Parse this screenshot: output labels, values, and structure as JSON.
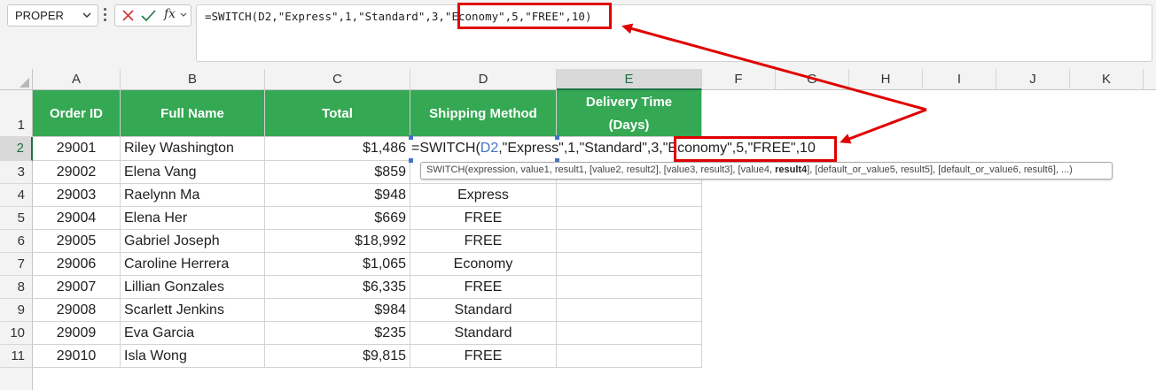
{
  "name_box": {
    "value": "PROPER"
  },
  "formula_bar": {
    "fx_label": "fx",
    "formula": "=SWITCH(D2,\"Express\",1,\"Standard\",3,\"Economy\",5,\"FREE\",10)"
  },
  "columns": [
    "A",
    "B",
    "C",
    "D",
    "E",
    "F",
    "G",
    "H",
    "I",
    "J",
    "K"
  ],
  "rows": [
    "1",
    "2",
    "3",
    "4",
    "5",
    "6",
    "7",
    "8",
    "9",
    "10",
    "11"
  ],
  "table": {
    "headers": {
      "order_id": "Order ID",
      "full_name": "Full Name",
      "total": "Total",
      "shipping_method": "Shipping Method",
      "delivery_time_line1": "Delivery Time",
      "delivery_time_line2": "(Days)"
    },
    "rows": [
      {
        "order_id": "29001",
        "full_name": "Riley Washington",
        "total": "$1,486",
        "shipping_method": ""
      },
      {
        "order_id": "29002",
        "full_name": "Elena Vang",
        "total": "$859",
        "shipping_method": ""
      },
      {
        "order_id": "29003",
        "full_name": "Raelynn Ma",
        "total": "$948",
        "shipping_method": "Express"
      },
      {
        "order_id": "29004",
        "full_name": "Elena Her",
        "total": "$669",
        "shipping_method": "FREE"
      },
      {
        "order_id": "29005",
        "full_name": "Gabriel Joseph",
        "total": "$18,992",
        "shipping_method": "FREE"
      },
      {
        "order_id": "29006",
        "full_name": "Caroline Herrera",
        "total": "$1,065",
        "shipping_method": "Economy"
      },
      {
        "order_id": "29007",
        "full_name": "Lillian Gonzales",
        "total": "$6,335",
        "shipping_method": "FREE"
      },
      {
        "order_id": "29008",
        "full_name": "Scarlett Jenkins",
        "total": "$984",
        "shipping_method": "Standard"
      },
      {
        "order_id": "29009",
        "full_name": "Eva Garcia",
        "total": "$235",
        "shipping_method": "Standard"
      },
      {
        "order_id": "29010",
        "full_name": "Isla Wong",
        "total": "$9,815",
        "shipping_method": "FREE"
      }
    ]
  },
  "cell_editor": {
    "prefix": "=SWITCH(",
    "ref": "D2",
    "middle": ",\"Express\",1,\"Standard\",3,",
    "highlight": "\"Economy\",5,\"FREE\",10"
  },
  "formula_highlight": "\"Economy\",5,\"FREE\",10",
  "tooltip": {
    "before": "SWITCH(expression, value1, result1, [value2, result2], [value3, result3], [value4, ",
    "bold": "result4",
    "after": "], [default_or_value5, result5], [default_or_value6, result6], ...)"
  },
  "colors": {
    "header_fill": "#34a853",
    "annotation_red": "#e00000",
    "reference_blue": "#4472c4",
    "excel_green": "#1e7145"
  },
  "icons": [
    "chevron-down-icon",
    "cancel-x-icon",
    "confirm-check-icon",
    "fx-icon"
  ]
}
